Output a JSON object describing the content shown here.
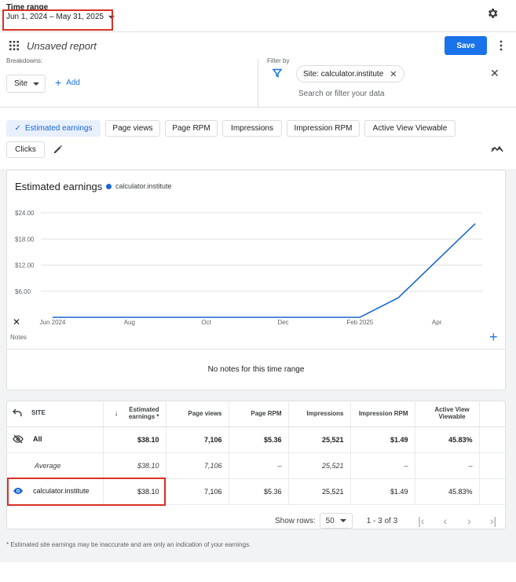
{
  "time_range": {
    "label": "Time range",
    "value": "Jun 1, 2024 – May 31, 2025"
  },
  "report": {
    "title": "Unsaved report",
    "save_label": "Save"
  },
  "breakdowns": {
    "label": "Breakdowns:",
    "site_label": "Site",
    "add_label": "Add"
  },
  "filter": {
    "label": "Filter by",
    "chip_label": "Site: calculator.institute",
    "search_placeholder": "Search or filter your data"
  },
  "metrics": [
    {
      "label": "Estimated earnings",
      "active": true
    },
    {
      "label": "Page views",
      "active": false
    },
    {
      "label": "Page RPM",
      "active": false
    },
    {
      "label": "Impressions",
      "active": false
    },
    {
      "label": "Impression RPM",
      "active": false
    },
    {
      "label": "Active View Viewable",
      "active": false
    },
    {
      "label": "Clicks",
      "active": false
    }
  ],
  "chart_data": {
    "type": "line",
    "title": "Estimated earnings",
    "series": [
      {
        "name": "calculator.institute",
        "color": "#1967d2",
        "x": [
          "2024-06",
          "2024-07",
          "2024-08",
          "2024-09",
          "2024-10",
          "2024-11",
          "2024-12",
          "2025-01",
          "2025-02",
          "2025-03",
          "2025-04",
          "2025-05"
        ],
        "values": [
          0,
          0,
          0,
          0,
          0,
          0,
          0,
          0,
          0,
          4.5,
          13,
          21.5
        ]
      }
    ],
    "x_tick_labels": [
      "Jun 2024",
      "Aug",
      "Oct",
      "Dec",
      "Feb 2025",
      "Apr"
    ],
    "y_tick_labels": [
      "$6.00",
      "$12.00",
      "$18.00",
      "$24.00"
    ],
    "yticks": [
      6,
      12,
      18,
      24
    ],
    "ylim": [
      0,
      24
    ],
    "grid": true
  },
  "notes": {
    "label": "Notes",
    "empty_text": "No notes for this time range"
  },
  "table": {
    "columns": [
      "SITE",
      "Estimated earnings *",
      "Page views",
      "Page RPM",
      "Impressions",
      "Impression RPM",
      "Active View Viewable"
    ],
    "rows": [
      {
        "type": "all",
        "cells": [
          "All",
          "$38.10",
          "7,106",
          "$5.36",
          "25,521",
          "$1.49",
          "45.83%"
        ]
      },
      {
        "type": "avg",
        "cells": [
          "Average",
          "$38.10",
          "7,106",
          "–",
          "25,521",
          "–",
          "–"
        ]
      },
      {
        "type": "site",
        "cells": [
          "calculator.institute",
          "$38.10",
          "7,106",
          "$5.36",
          "25,521",
          "$1.49",
          "45.83%"
        ]
      }
    ]
  },
  "pagination": {
    "show_rows_label": "Show rows:",
    "rows_value": "50",
    "range_text": "1 - 3 of 3"
  },
  "footnote": "* Estimated site earnings may be inaccurate and are only an indication of your earnings.",
  "colors": {
    "accent": "#1a73e8",
    "highlight": "#d93025",
    "series": "#1967d2"
  }
}
